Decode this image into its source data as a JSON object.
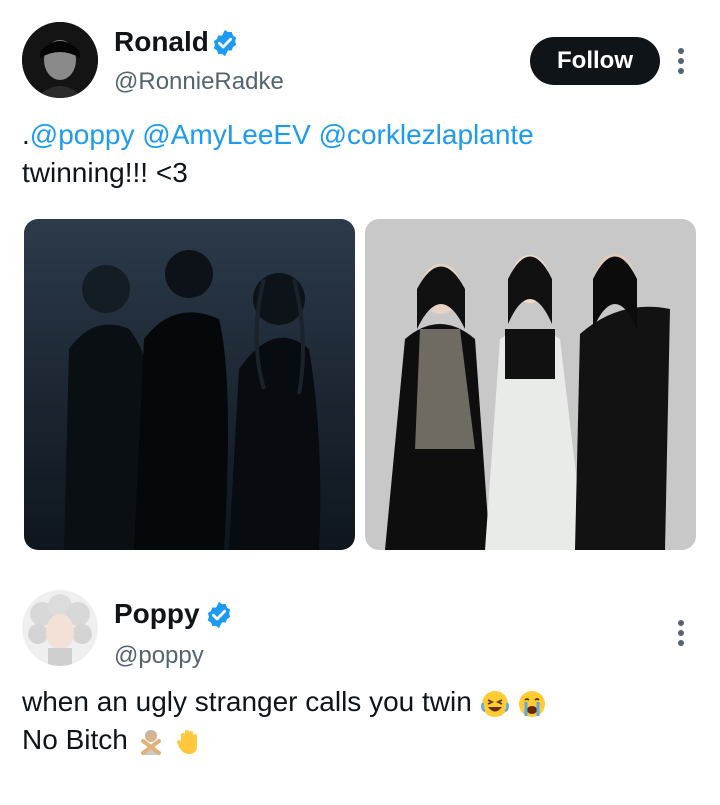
{
  "tweet1": {
    "author_name": "Ronald",
    "handle": "@RonnieRadke",
    "follow_label": "Follow",
    "prefix": ".",
    "mentions": [
      "@poppy",
      "@AmyLeeEV",
      "@corklezlaplante"
    ],
    "text_line2": "twinning!!! <3",
    "avatar_icon": "profile-photo",
    "verified_icon": "verified-badge",
    "accent": "#1d9bf0"
  },
  "tweet2": {
    "author_name": "Poppy",
    "handle": "@poppy",
    "text_line1": "when an ugly stranger calls you twin",
    "text_line2": "No Bitch",
    "emojis_line1": [
      "laughing-emoji",
      "crying-emoji"
    ],
    "emojis_line2": [
      "no-gesture-emoji",
      "raised-hand-emoji"
    ]
  },
  "colors": {
    "text": "#0f1419",
    "secondary": "#536471",
    "link": "#1d9bf0",
    "button": "#0f1419"
  }
}
